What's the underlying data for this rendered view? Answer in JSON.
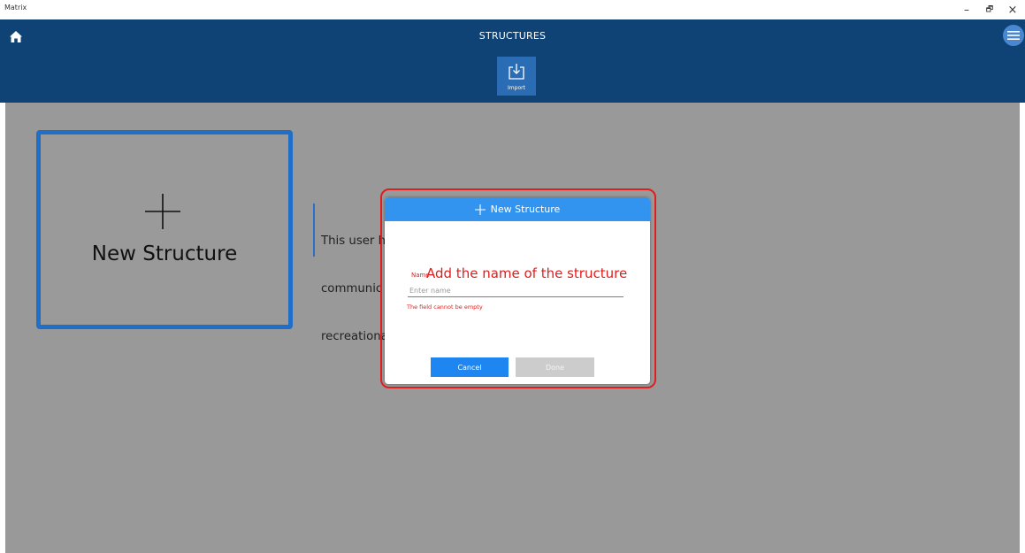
{
  "window": {
    "title": "Matrix",
    "minimize": "–",
    "maximize": "🗗",
    "close": "×"
  },
  "header": {
    "title": "STRUCTURES",
    "import_label": "Import",
    "icons": {
      "home": "home-icon",
      "menu": "hamburger-menu-icon",
      "import": "import-icon"
    },
    "colors": {
      "background": "#0f4275",
      "import_button": "#2a6db4",
      "menu_button": "#4a87d1"
    }
  },
  "card": {
    "label": "New Structure",
    "icon": "plus-icon",
    "border_color": "#1f6ec7"
  },
  "info": {
    "lines": [
      "This user h                                              seful for",
      "communic                                                not, even for",
      "recreationa"
    ]
  },
  "dialog": {
    "title": "New Structure",
    "title_icon": "plus-icon",
    "field_label": "Name",
    "field_placeholder": "Enter name",
    "field_value": "",
    "error": "The field cannot be empty",
    "cancel_label": "Cancel",
    "done_label": "Done",
    "colors": {
      "header": "#3394ef",
      "cancel": "#1e86f0",
      "done_disabled": "#cccccc",
      "error": "#e11d1d"
    }
  },
  "annotation": {
    "text": "Add the name of the structure",
    "color": "#e11d1d"
  }
}
